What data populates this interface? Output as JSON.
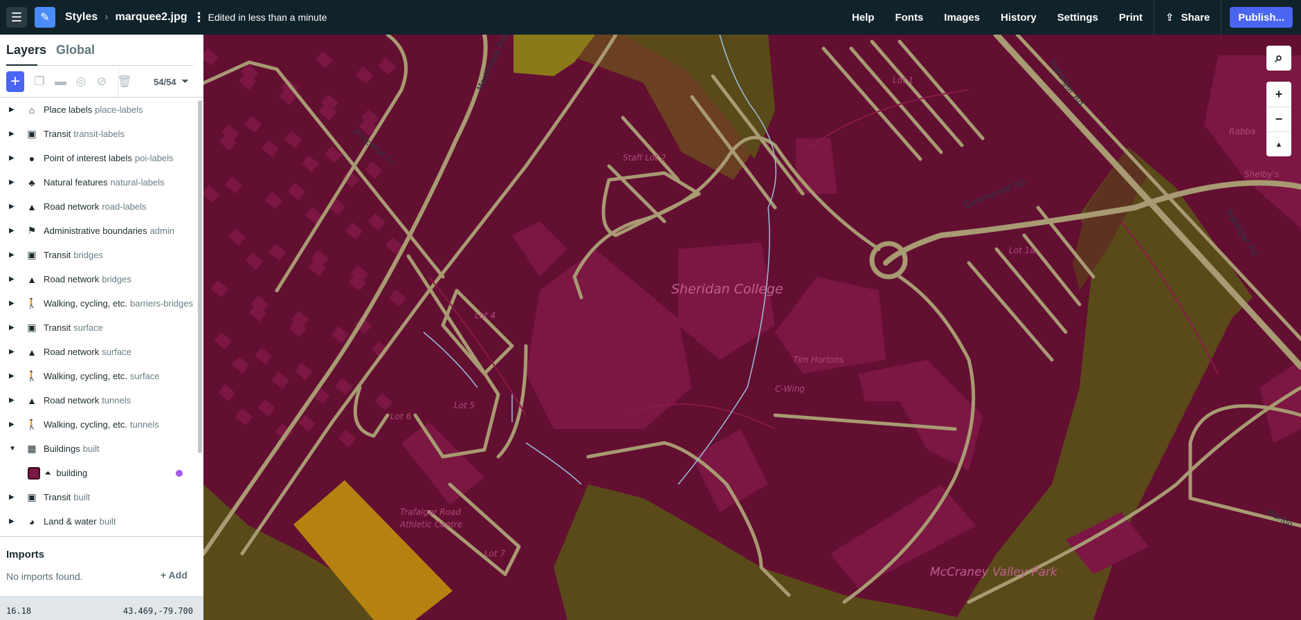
{
  "topbar": {
    "breadcrumb_root": "Styles",
    "style_name": "marquee2.jpg",
    "status": "Edited in less than a minute",
    "nav": [
      "Help",
      "Fonts",
      "Images",
      "History",
      "Settings",
      "Print"
    ],
    "share": "Share",
    "publish": "Publish..."
  },
  "sidebar": {
    "tabs": [
      "Layers",
      "Global"
    ],
    "layer_count": "54/54",
    "layers": [
      {
        "name": "Place labels",
        "source": "place-labels",
        "icon": "place-icon"
      },
      {
        "name": "Transit",
        "source": "transit-labels",
        "icon": "transit-icon"
      },
      {
        "name": "Point of interest labels",
        "source": "poi-labels",
        "icon": "pin-icon"
      },
      {
        "name": "Natural features",
        "source": "natural-labels",
        "icon": "nature-icon"
      },
      {
        "name": "Road network",
        "source": "road-labels",
        "icon": "road-icon"
      },
      {
        "name": "Administrative boundaries",
        "source": "admin",
        "icon": "flag-icon"
      },
      {
        "name": "Transit",
        "source": "bridges",
        "icon": "transit-icon"
      },
      {
        "name": "Road network",
        "source": "bridges",
        "icon": "road-icon"
      },
      {
        "name": "Walking, cycling, etc.",
        "source": "barriers-bridges",
        "icon": "walking-icon"
      },
      {
        "name": "Transit",
        "source": "surface",
        "icon": "transit-icon"
      },
      {
        "name": "Road network",
        "source": "surface",
        "icon": "road-icon"
      },
      {
        "name": "Walking, cycling, etc.",
        "source": "surface",
        "icon": "walking-icon"
      },
      {
        "name": "Road network",
        "source": "tunnels",
        "icon": "road-icon"
      },
      {
        "name": "Walking, cycling, etc.",
        "source": "tunnels",
        "icon": "walking-icon"
      },
      {
        "name": "Buildings",
        "source": "built",
        "icon": "building-icon",
        "expanded": true
      },
      {
        "name": "Transit",
        "source": "built",
        "icon": "transit-icon"
      },
      {
        "name": "Land & water",
        "source": "built",
        "icon": "globe-icon"
      }
    ],
    "sublayer": {
      "name": "building",
      "color": "#7b1742"
    },
    "imports": {
      "title": "Imports",
      "empty": "No imports found.",
      "add": "Add"
    },
    "footer": {
      "zoom": "16.18",
      "coords": "43.469,-79.700"
    }
  },
  "map": {
    "colors": {
      "land": "#620f31",
      "building": "#7b1742",
      "road": "#a89a72",
      "park": "#5a4a1a",
      "wood": "#6a3f22",
      "field": "#b5820f",
      "yellow": "#8a7a1a",
      "water": "#9fc0e0"
    },
    "labels": {
      "martindale": "Martindale Ave",
      "princeton": "Princeton Cr",
      "staff_lot": "Staff Lot 2",
      "lot1": "Lot 1",
      "trafalgar1": "Trafalgar Rd",
      "trafalgar2": "Trafalgar Rd",
      "rabba": "Rabba",
      "shelbys": "Shelby's",
      "ceremonial": "Ceremonial Rd",
      "lot1a": "Lot 1a",
      "sheridan": "Sheridan College",
      "lot4": "Lot 4",
      "tim": "Tim Hortons",
      "cwing": "C-Wing",
      "lot5": "Lot 5",
      "lot6": "Lot 6",
      "athletic1": "Trafalgar Road",
      "athletic2": "Athletic Centre",
      "lot7": "Lot 7",
      "mccraney": "McCraney Valley Park",
      "marlbo": "Marlbo"
    }
  }
}
